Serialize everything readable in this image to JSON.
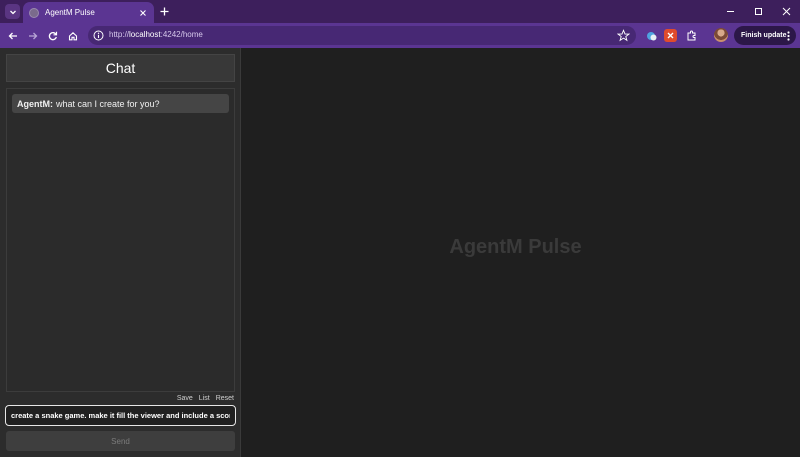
{
  "browser": {
    "tab_title": "AgentM Pulse",
    "url_prefix": "http://",
    "url_host": "localhost",
    "url_path": ":4242/home",
    "finish_update_label": "Finish update",
    "accent_color": "#5b3592"
  },
  "chat": {
    "title": "Chat",
    "messages": [
      {
        "sender": "AgentM:",
        "text": "what can I create for you?"
      }
    ],
    "actions": {
      "save": "Save",
      "list": "List",
      "reset": "Reset"
    },
    "input_value": "create a snake game. make it fill the viewer and include a score",
    "send_label": "Send"
  },
  "viewer": {
    "placeholder_title": "AgentM Pulse"
  }
}
